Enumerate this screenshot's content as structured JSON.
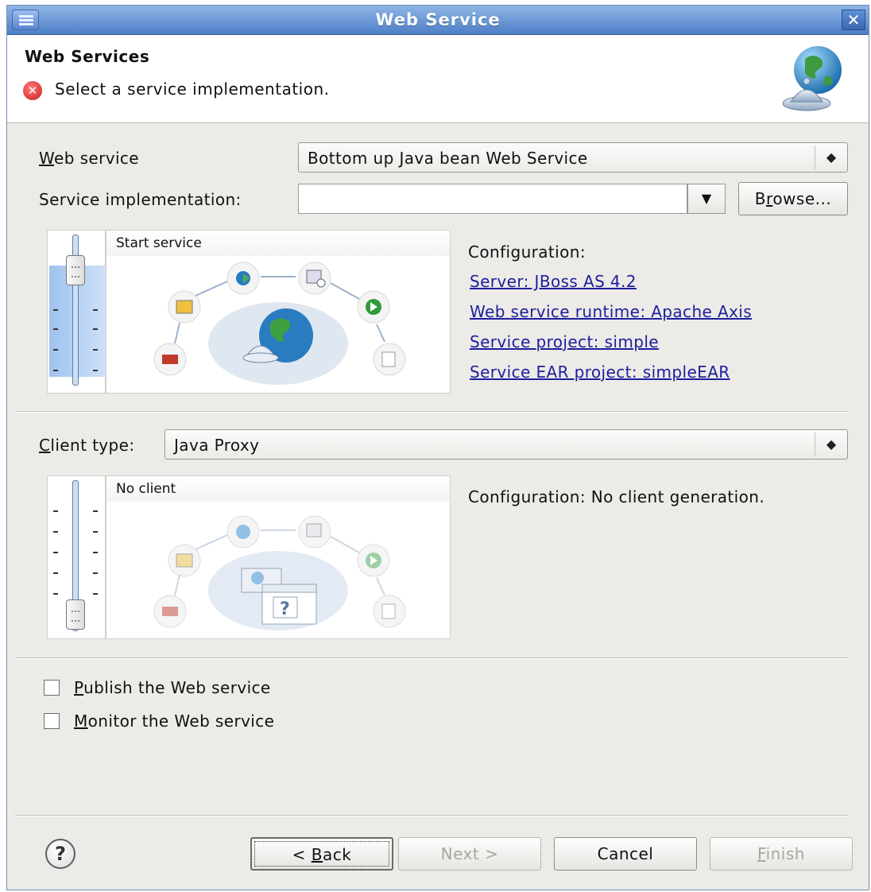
{
  "window": {
    "title": "Web Service"
  },
  "header": {
    "title": "Web Services",
    "message": "Select a service implementation."
  },
  "service": {
    "web_service_label_mnemonic": "W",
    "web_service_label_rest": "eb service",
    "web_service_value": "Bottom up Java bean Web Service",
    "implementation_label": "Service implementation:",
    "implementation_value": "",
    "browse_label_pre": "B",
    "browse_label_mnemonic": "r",
    "browse_label_post": "owse...",
    "slider_level_label": "Start service",
    "configuration_label": "Configuration:",
    "links": [
      "Server: JBoss AS 4.2",
      "Web service runtime: Apache Axis",
      "Service project: simple",
      "Service EAR project: simpleEAR"
    ]
  },
  "client": {
    "type_label_mnemonic": "C",
    "type_label_rest": "lient type:",
    "type_value": "Java Proxy",
    "slider_level_label": "No client",
    "configuration_text": "Configuration: No client generation."
  },
  "options": {
    "publish_mnemonic": "P",
    "publish_rest": "ublish the Web service",
    "publish_checked": false,
    "monitor_mnemonic": "M",
    "monitor_rest": "onitor the Web service",
    "monitor_checked": false
  },
  "buttons": {
    "back_pre": "< ",
    "back_mnemonic": "B",
    "back_post": "ack",
    "next": "Next >",
    "cancel": "Cancel",
    "finish_mnemonic": "F",
    "finish_post": "inish"
  },
  "colors": {
    "accent": "#4d7fc7",
    "link": "#1e1e9c",
    "error": "#c81b1b"
  }
}
